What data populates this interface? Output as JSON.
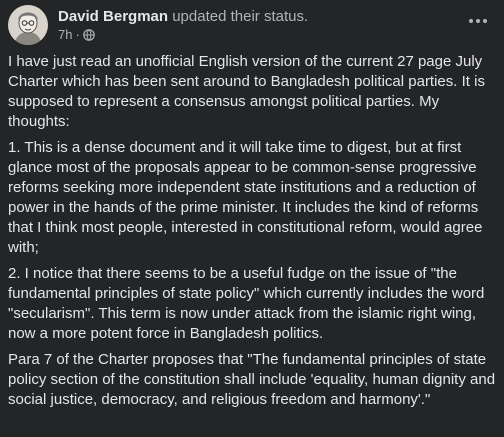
{
  "post": {
    "author": "David Bergman",
    "action": "updated their status.",
    "time": "7h",
    "separator": "·",
    "audience_icon": "globe-icon",
    "more_icon": "more-options-icon",
    "paragraphs": [
      "I have just read an unofficial English version of the current 27 page July Charter which has been sent around to Bangladesh political parties. It is supposed to represent a consensus amongst political parties. My thoughts:",
      "1. This is a dense document and it will take time to digest, but at first glance most of the proposals appear to be common-sense progressive reforms seeking more independent state institutions and a reduction of power in the hands of the prime minister. It includes the kind of reforms that I think most people, interested in constitutional reform, would agree with;",
      "2. I notice that there seems to be a useful fudge on the issue of \"the fundamental principles of state policy\" which currently includes the word \"secularism\". This term is now under attack from the islamic right wing, now a more potent force in Bangladesh politics.",
      "Para 7 of the  Charter proposes that \"The fundamental principles of state policy section of the constitution shall include 'equality, human dignity and social justice, democracy, and religious freedom and harmony'.\""
    ]
  },
  "colors": {
    "background": "#242526",
    "primary_text": "#e4e6eb",
    "secondary_text": "#b0b3b8"
  }
}
